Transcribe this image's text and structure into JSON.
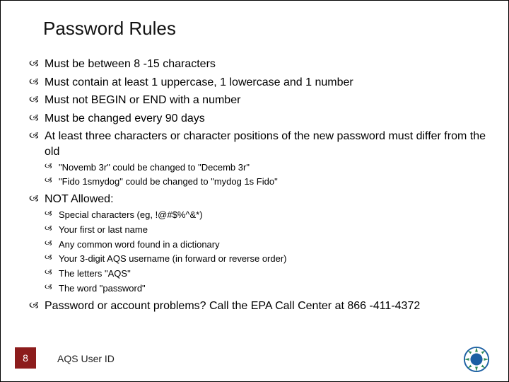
{
  "title": "Password Rules",
  "rules": [
    "Must be between 8 -15 characters",
    "Must contain at least 1 uppercase, 1 lowercase and 1 number",
    "Must not BEGIN or END with a number",
    "Must be changed every 90 days",
    "At least three characters or character positions of the new password must differ from the old"
  ],
  "examples": [
    "\"Novemb 3r\" could be changed to \"Decemb 3r\"",
    "\"Fido 1smydog\" could be changed to \"mydog 1s Fido\""
  ],
  "not_allowed_label": "NOT Allowed:",
  "not_allowed": [
    "Special characters (eg, !@#$%^&*)",
    "Your first or last name",
    "Any common word found in a dictionary",
    "Your 3-digit AQS username (in forward or reverse order)",
    "The letters \"AQS\"",
    "The word \"password\""
  ],
  "help": "Password or account problems?  Call the EPA Call Center at 866 -411-4372",
  "page_number": "8",
  "footer_label": "AQS User ID"
}
